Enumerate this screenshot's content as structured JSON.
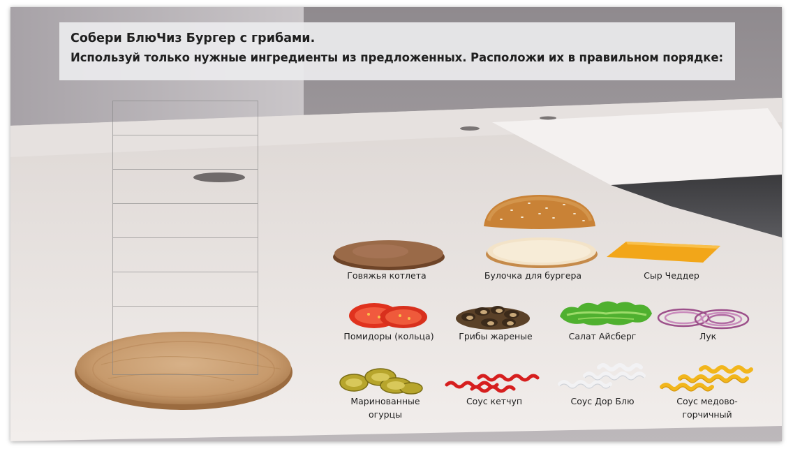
{
  "task": {
    "title": "Собери БлюЧиз Бургер с грибами.",
    "instruction": "Используй только нужные ингредиенты из предложенных. Расположи их в правильном порядке:"
  },
  "ingredients": [
    {
      "id": "beef-patty",
      "label": "Говяжья котлета"
    },
    {
      "id": "burger-bun",
      "label": "Булочка для бургера"
    },
    {
      "id": "cheddar",
      "label": "Сыр Чеддер"
    },
    {
      "id": "tomatoes",
      "label": "Помидоры (кольца)"
    },
    {
      "id": "mushrooms",
      "label": "Грибы жареные"
    },
    {
      "id": "lettuce",
      "label": "Салат Айсберг"
    },
    {
      "id": "onion",
      "label": "Лук"
    },
    {
      "id": "pickles",
      "label": "Маринованные огурцы"
    },
    {
      "id": "ketchup",
      "label": "Соус кетчуп"
    },
    {
      "id": "dor-blue",
      "label": "Соус Дор Блю"
    },
    {
      "id": "honey-mustard",
      "label": "Соус медово-горчичный"
    }
  ],
  "stack_slots": 8
}
